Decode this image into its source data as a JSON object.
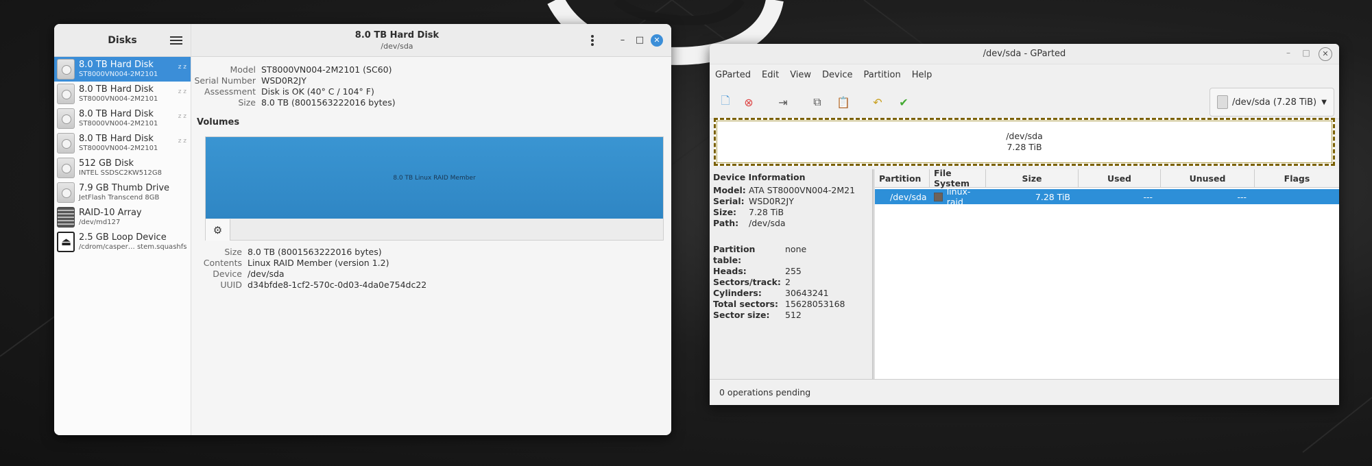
{
  "disks": {
    "sidebar_title": "Disks",
    "drives": [
      {
        "name": "8.0 TB Hard Disk",
        "sub": "ST8000VN004-2M2101",
        "icon": "hard-disk-icon",
        "zz": "z z"
      },
      {
        "name": "8.0 TB Hard Disk",
        "sub": "ST8000VN004-2M2101",
        "icon": "hard-disk-icon",
        "zz": "z z"
      },
      {
        "name": "8.0 TB Hard Disk",
        "sub": "ST8000VN004-2M2101",
        "icon": "hard-disk-icon",
        "zz": "z z"
      },
      {
        "name": "8.0 TB Hard Disk",
        "sub": "ST8000VN004-2M2101",
        "icon": "hard-disk-icon",
        "zz": "z z"
      },
      {
        "name": "512 GB Disk",
        "sub": "INTEL SSDSC2KW512G8",
        "icon": "hard-disk-icon"
      },
      {
        "name": "7.9 GB Thumb Drive",
        "sub": "JetFlash Transcend 8GB",
        "icon": "usb-drive-icon"
      },
      {
        "name": "RAID-10 Array",
        "sub": "/dev/md127",
        "icon": "raid-array-icon"
      },
      {
        "name": "2.5 GB Loop Device",
        "sub": "/cdrom/casper… stem.squashfs",
        "icon": "eject-icon"
      }
    ],
    "header_title": "8.0 TB Hard Disk",
    "header_sub": "/dev/sda",
    "details": [
      {
        "k": "Model",
        "v": "ST8000VN004-2M2101 (SC60)"
      },
      {
        "k": "Serial Number",
        "v": "WSD0R2JY"
      },
      {
        "k": "Assessment",
        "v": "Disk is OK (40° C / 104° F)"
      },
      {
        "k": "Size",
        "v": "8.0 TB (8001563222016 bytes)"
      }
    ],
    "volumes_title": "Volumes",
    "volume_label": "8.0 TB Linux RAID Member",
    "volume_details": [
      {
        "k": "Size",
        "v": "8.0 TB (8001563222016 bytes)"
      },
      {
        "k": "Contents",
        "v": "Linux RAID Member (version 1.2)"
      },
      {
        "k": "Device",
        "v": "/dev/sda"
      },
      {
        "k": "UUID",
        "v": "d34bfde8-1cf2-570c-0d03-4da0e754dc22"
      }
    ],
    "accent": "#3b8ed8"
  },
  "gparted": {
    "title": "/dev/sda - GParted",
    "menu": [
      "GParted",
      "Edit",
      "View",
      "Device",
      "Partition",
      "Help"
    ],
    "device_selector": "/dev/sda  (7.28 TiB)",
    "diskmap_line1": "/dev/sda",
    "diskmap_line2": "7.28 TiB",
    "devinfo_title": "Device Information",
    "devinfo_a": [
      {
        "k": "Model:",
        "v": "ATA ST8000VN004-2M21"
      },
      {
        "k": "Serial:",
        "v": "WSD0R2JY"
      },
      {
        "k": "Size:",
        "v": "7.28 TiB"
      },
      {
        "k": "Path:",
        "v": "/dev/sda"
      }
    ],
    "devinfo_b": [
      {
        "k": "Partition table:",
        "v": "none"
      },
      {
        "k": "Heads:",
        "v": "255"
      },
      {
        "k": "Sectors/track:",
        "v": "2"
      },
      {
        "k": "Cylinders:",
        "v": "30643241"
      },
      {
        "k": "Total sectors:",
        "v": "15628053168"
      },
      {
        "k": "Sector size:",
        "v": "512"
      }
    ],
    "columns": [
      "Partition",
      "File System",
      "Size",
      "Used",
      "Unused",
      "Flags"
    ],
    "row": {
      "partition": "/dev/sda",
      "fs": "linux-raid",
      "size": "7.28 TiB",
      "used": "---",
      "unused": "---",
      "flags": ""
    },
    "status": "0 operations pending",
    "selection_color": "#2d8fd8"
  }
}
